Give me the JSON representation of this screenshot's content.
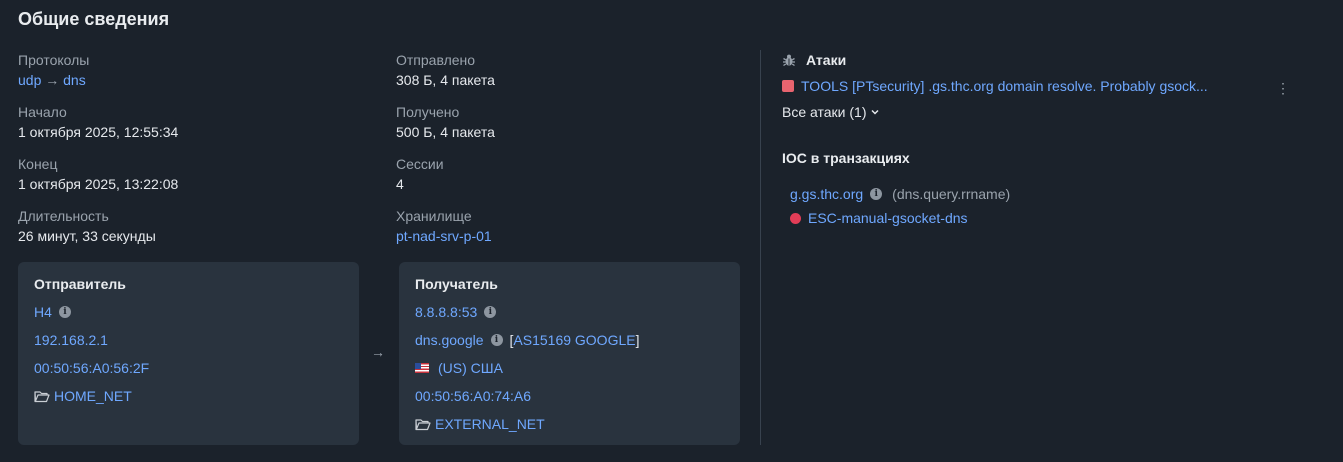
{
  "title": "Общие сведения",
  "general": {
    "protocols": {
      "label": "Протоколы",
      "from": "udp",
      "arrow": "→",
      "to": "dns"
    },
    "start": {
      "label": "Начало",
      "value": "1 октября 2025, 12:55:34"
    },
    "end": {
      "label": "Конец",
      "value": "1 октября 2025, 13:22:08"
    },
    "duration": {
      "label": "Длительность",
      "value": "26 минут, 33 секунды"
    },
    "sent": {
      "label": "Отправлено",
      "value": "308 Б, 4 пакета"
    },
    "received": {
      "label": "Получено",
      "value": "500 Б, 4 пакета"
    },
    "sessions": {
      "label": "Сессии",
      "value": "4"
    },
    "storage": {
      "label": "Хранилище",
      "value": "pt-nad-srv-p-01"
    }
  },
  "sender": {
    "title": "Отправитель",
    "host": "H4",
    "ip": "192.168.2.1",
    "mac": "00:50:56:A0:56:2F",
    "net": "HOME_NET"
  },
  "between_arrow": "→",
  "receiver": {
    "title": "Получатель",
    "ip_port": "8.8.8.8:53",
    "hostname": "dns.google",
    "bracket_open": "[",
    "asn": "AS15169 GOOGLE",
    "bracket_close": "]",
    "country": "(US) США",
    "mac": "00:50:56:A0:74:A6",
    "net": "EXTERNAL_NET"
  },
  "attacks": {
    "title": "Атаки",
    "icon": "bug-icon",
    "items": [
      {
        "name": "TOOLS [PTsecurity] .gs.thc.org domain resolve. Probably gsock...",
        "color": "#e8646f"
      }
    ],
    "all_label": "Все атаки (1)"
  },
  "ioc": {
    "title": "IOC в транзакциях",
    "items": [
      {
        "value": "g.gs.thc.org",
        "field": "(dns.query.rrname)"
      },
      {
        "value": "ESC-manual-gsocket-dns",
        "color": "#e23d57"
      }
    ]
  },
  "colors": {
    "accent": "#6fa8ff",
    "background": "#1b222b",
    "card": "#29333e"
  }
}
